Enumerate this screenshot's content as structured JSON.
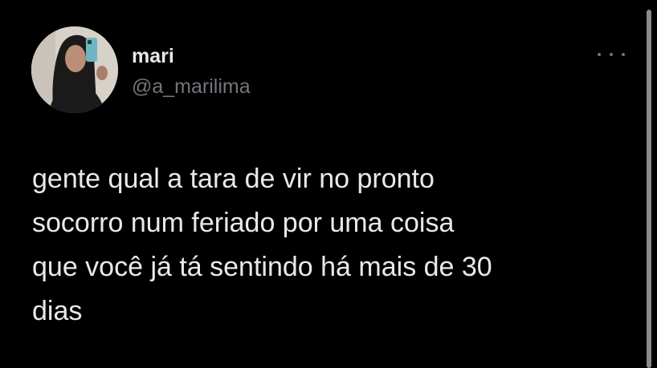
{
  "author": {
    "display_name": "mari",
    "handle": "@a_marilima",
    "avatar_icon": "profile-photo"
  },
  "tweet": {
    "text": "gente qual a tara de vir no pronto\nsocorro num feriado por uma coisa\nque você já tá sentindo há mais de 30\ndias"
  },
  "icons": {
    "more": "more-options-icon"
  },
  "colors": {
    "background": "#000000",
    "primary_text": "#e7e9ea",
    "secondary_text": "#71767b"
  }
}
